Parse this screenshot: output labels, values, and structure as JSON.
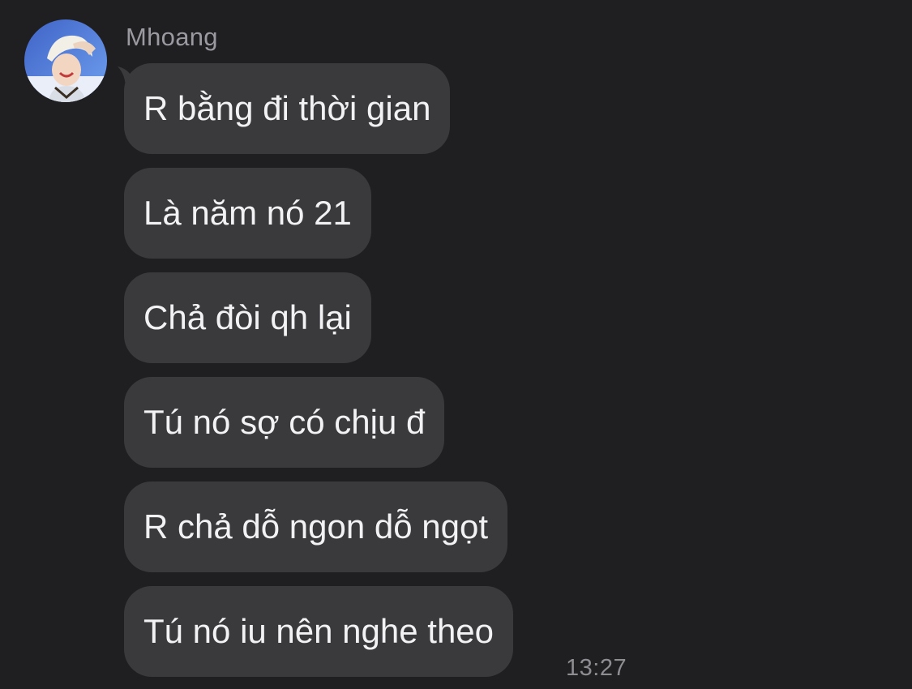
{
  "conversation": {
    "sender_name": "Mhoang",
    "avatar_icon": "user-avatar-photo",
    "messages": [
      {
        "text": "R bằng đi thời gian"
      },
      {
        "text": "Là năm nó 21"
      },
      {
        "text": "Chả đòi qh lại"
      },
      {
        "text": "Tú nó sợ có chịu đ"
      },
      {
        "text": "R chả dỗ ngon dỗ ngọt"
      },
      {
        "text": "Tú nó iu nên nghe theo"
      }
    ],
    "timestamp": "13:27"
  },
  "colors": {
    "background": "#1f1f21",
    "bubble": "#3a3a3d",
    "text": "#f2f2f4",
    "secondary_text": "#9a9aa0"
  }
}
